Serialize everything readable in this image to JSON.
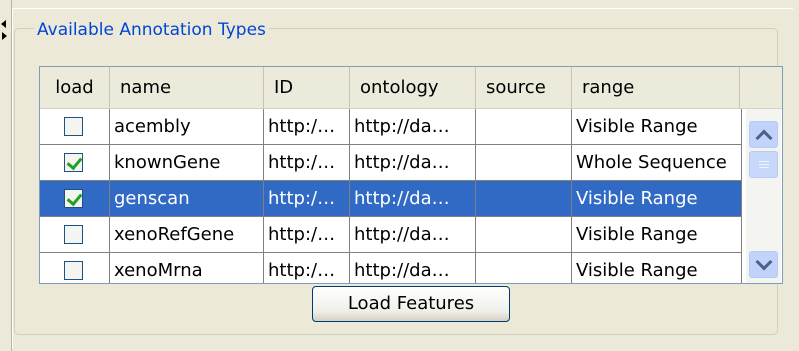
{
  "panel": {
    "group_title": "Available Annotation Types",
    "load_button_label": "Load Features"
  },
  "table": {
    "columns": [
      "load",
      "name",
      "ID",
      "ontology",
      "source",
      "range"
    ],
    "rows": [
      {
        "load": false,
        "name": "acembly",
        "id": "http:/…",
        "ontology": "http://da…",
        "source": "",
        "range": "Visible Range",
        "selected": false
      },
      {
        "load": true,
        "name": "knownGene",
        "id": "http:/…",
        "ontology": "http://da…",
        "source": "",
        "range": "Whole Sequence",
        "selected": false
      },
      {
        "load": true,
        "name": "genscan",
        "id": "http:/…",
        "ontology": "http://da…",
        "source": "",
        "range": "Visible Range",
        "selected": true
      },
      {
        "load": false,
        "name": "xenoRefGene",
        "id": "http:/…",
        "ontology": "http://da…",
        "source": "",
        "range": "Visible Range",
        "selected": false
      },
      {
        "load": false,
        "name": "xenoMrna",
        "id": "http:/…",
        "ontology": "http://da…",
        "source": "",
        "range": "Visible Range",
        "selected": false
      }
    ]
  },
  "icons": {
    "scroll_up": "chevron-up-icon",
    "scroll_down": "chevron-down-icon",
    "checkbox_checked": "checkmark-icon"
  },
  "colors": {
    "selection": "#316ac5",
    "group_title": "#0046d5",
    "check": "#21a121"
  }
}
